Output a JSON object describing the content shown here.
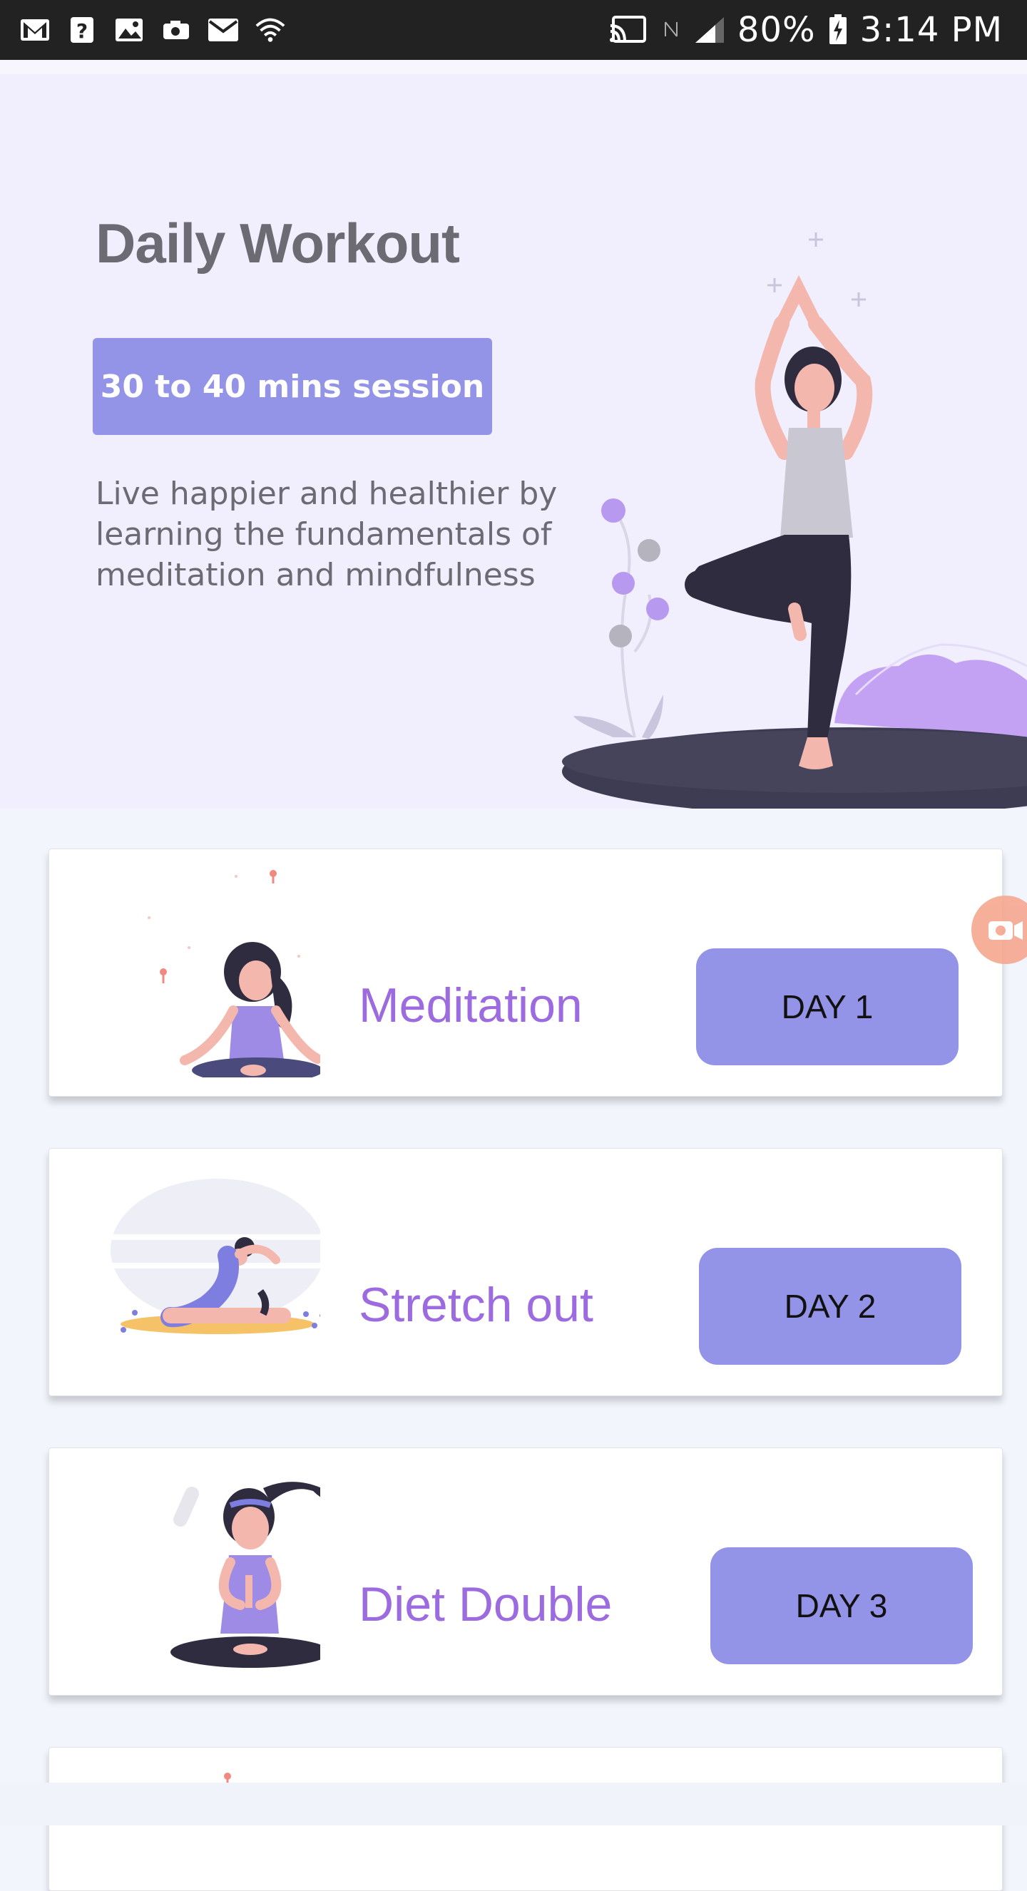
{
  "status_bar": {
    "battery": "80%",
    "time": "3:14 PM",
    "left_icons": [
      "gmail-icon",
      "help-icon",
      "image-icon",
      "camera-icon",
      "mail-icon",
      "wifi-icon"
    ],
    "right_icons": [
      "cast-icon",
      "nfc-icon",
      "signal-icon",
      "battery-charging-icon"
    ]
  },
  "hero": {
    "title": "Daily Workout",
    "session_button": "30 to 40 mins session",
    "description": "Live happier and healthier by learning the fundamentals of meditation and mindfulness",
    "illustration": "yoga-tree-pose-illustration"
  },
  "cards": [
    {
      "title": "Meditation",
      "day_button": "DAY 1",
      "image": "meditation-illustration"
    },
    {
      "title": "Stretch out",
      "day_button": "DAY 2",
      "image": "stretch-illustration"
    },
    {
      "title": "Diet Double",
      "day_button": "DAY 3",
      "image": "diet-double-illustration"
    }
  ],
  "colors": {
    "accent": "#9393e8",
    "title_purple": "#9d6be0",
    "hero_bg": "#f1eefd",
    "page_bg": "#f3f5fd"
  }
}
